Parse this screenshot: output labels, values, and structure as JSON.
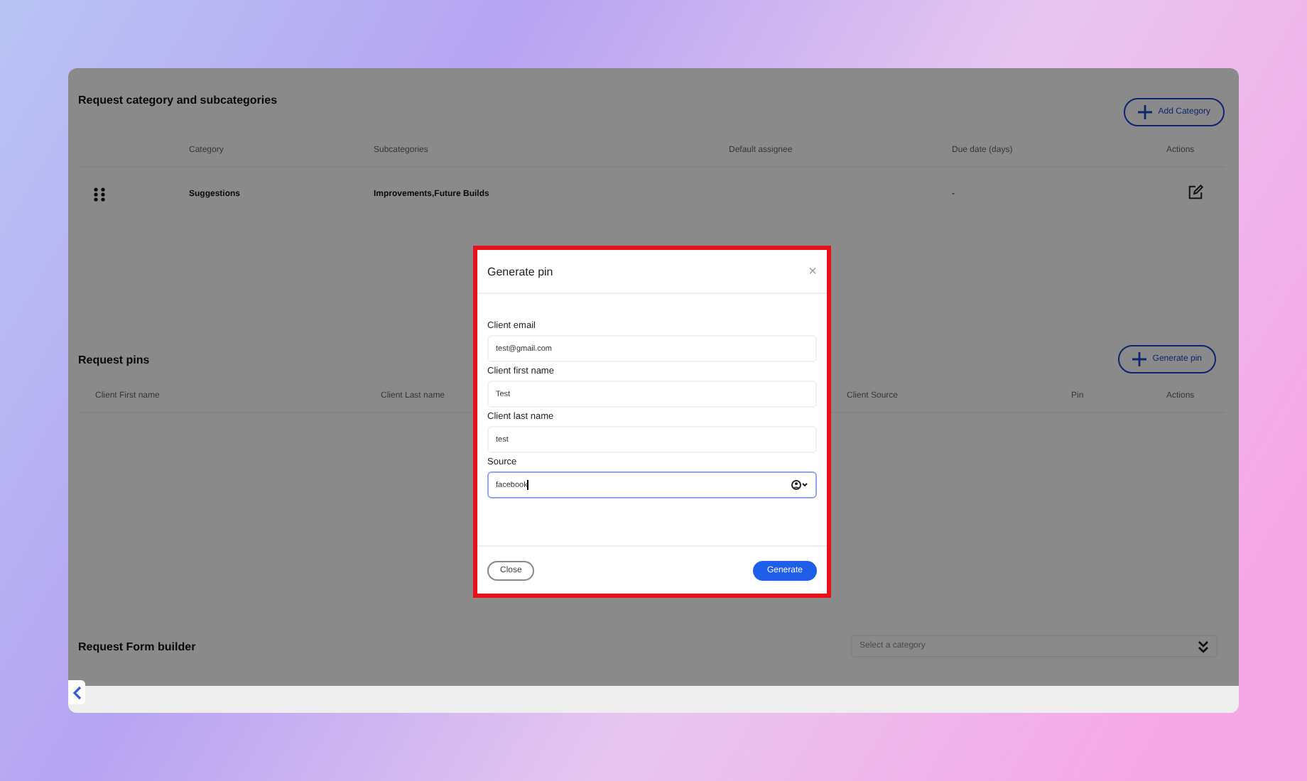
{
  "category_section": {
    "title": "Request category and subcategories",
    "add_button": "Add Category",
    "columns": [
      "Category",
      "Subcategories",
      "Default assignee",
      "Due date (days)",
      "Actions"
    ],
    "rows": [
      {
        "category": "Suggestions",
        "subcategories": "Improvements,Future Builds",
        "due_date": "-"
      }
    ]
  },
  "pins_section": {
    "title": "Request pins",
    "generate_button": "Generate pin",
    "columns": [
      "Client First name",
      "Client Last name",
      "Client Source",
      "Pin",
      "Actions"
    ]
  },
  "form_builder": {
    "title": "Request Form builder",
    "category_select": {
      "placeholder": "Select a category"
    }
  },
  "modal": {
    "title": "Generate pin",
    "close": "×",
    "fields": [
      {
        "label": "Client email",
        "value": "test@gmail.com",
        "kind": "text",
        "focused": false
      },
      {
        "label": "Client first name",
        "value": "Test",
        "kind": "text",
        "focused": false
      },
      {
        "label": "Client last name",
        "value": "test",
        "kind": "text",
        "focused": false
      },
      {
        "label": "Source",
        "value": "facebook",
        "kind": "select",
        "focused": true
      }
    ],
    "buttons": [
      {
        "label": "Close",
        "kind": "secondary"
      },
      {
        "label": "Generate",
        "kind": "primary"
      }
    ]
  }
}
